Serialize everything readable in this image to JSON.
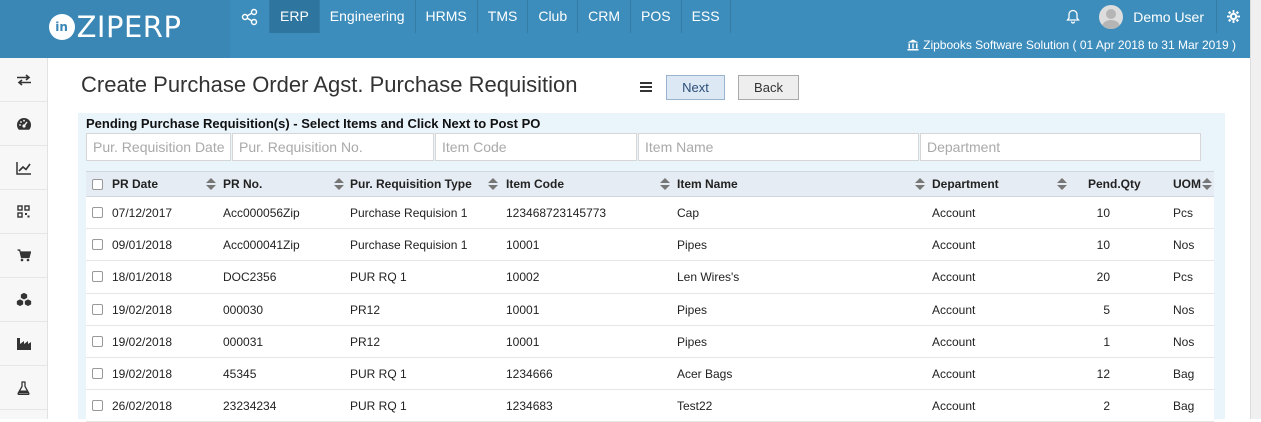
{
  "brand": {
    "logo_mark": "in",
    "name": "ZIPERP"
  },
  "nav": {
    "share_icon": "share-icon",
    "items": [
      {
        "label": "ERP",
        "active": true
      },
      {
        "label": "Engineering"
      },
      {
        "label": "HRMS"
      },
      {
        "label": "TMS"
      },
      {
        "label": "Club"
      },
      {
        "label": "CRM"
      },
      {
        "label": "POS"
      },
      {
        "label": "ESS"
      }
    ]
  },
  "user": {
    "name": "Demo User"
  },
  "company": {
    "text": "Zipbooks Software Solution ( 01 Apr 2018 to 31 Mar 2019 )"
  },
  "sidebar": {
    "icons": [
      "swap-icon",
      "dashboard-icon",
      "chart-icon",
      "qrcode-icon",
      "cart-icon",
      "cubes-icon",
      "factory-icon",
      "flask-icon"
    ]
  },
  "page": {
    "title": "Create Purchase Order Agst. Purchase Requisition",
    "next_label": "Next",
    "back_label": "Back"
  },
  "panel": {
    "heading": "Pending Purchase Requisition(s) - Select Items and Click Next to Post PO",
    "filters": {
      "pr_date": "Pur. Requisition Date",
      "pr_no": "Pur. Requisition No.",
      "item_code": "Item Code",
      "item_name": "Item Name",
      "department": "Department"
    }
  },
  "grid": {
    "columns": {
      "pr_date": "PR Date",
      "pr_no": "PR No.",
      "pr_type": "Pur. Requisition Type",
      "item_code": "Item Code",
      "item_name": "Item Name",
      "department": "Department",
      "pend_qty": "Pend.Qty",
      "uom": "UOM"
    },
    "rows": [
      {
        "pr_date": "07/12/2017",
        "pr_no": "Acc000056Zip",
        "pr_type": "Purchase Requision 1",
        "item_code": "123468723145773",
        "item_name": "Cap",
        "department": "Account",
        "pend_qty": "10",
        "uom": "Pcs"
      },
      {
        "pr_date": "09/01/2018",
        "pr_no": "Acc000041Zip",
        "pr_type": "Purchase Requision 1",
        "item_code": "10001",
        "item_name": "Pipes",
        "department": "Account",
        "pend_qty": "10",
        "uom": "Nos"
      },
      {
        "pr_date": "18/01/2018",
        "pr_no": "DOC2356",
        "pr_type": "PUR RQ 1",
        "item_code": "10002",
        "item_name": "Len Wires's",
        "department": "Account",
        "pend_qty": "20",
        "uom": "Pcs"
      },
      {
        "pr_date": "19/02/2018",
        "pr_no": "000030",
        "pr_type": "PR12",
        "item_code": "10001",
        "item_name": "Pipes",
        "department": "Account",
        "pend_qty": "5",
        "uom": "Nos"
      },
      {
        "pr_date": "19/02/2018",
        "pr_no": "000031",
        "pr_type": "PR12",
        "item_code": "10001",
        "item_name": "Pipes",
        "department": "Account",
        "pend_qty": "1",
        "uom": "Nos"
      },
      {
        "pr_date": "19/02/2018",
        "pr_no": "45345",
        "pr_type": "PUR RQ 1",
        "item_code": "1234666",
        "item_name": "Acer Bags",
        "department": "Account",
        "pend_qty": "12",
        "uom": "Bag"
      },
      {
        "pr_date": "26/02/2018",
        "pr_no": "23234234",
        "pr_type": "PUR RQ 1",
        "item_code": "1234683",
        "item_name": "Test22",
        "department": "Account",
        "pend_qty": "2",
        "uom": "Bag"
      }
    ]
  }
}
